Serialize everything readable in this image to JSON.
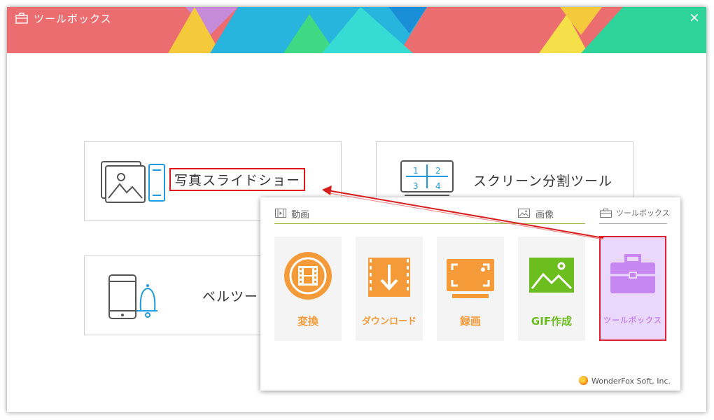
{
  "window": {
    "title": "ツールボックス",
    "close_glyph": "×"
  },
  "cards": {
    "photo_slideshow": {
      "label": "写真スライドショー"
    },
    "screen_split": {
      "label": "スクリーン分割ツール",
      "cells": [
        "1",
        "2",
        "3",
        "4"
      ]
    },
    "bell_tool": {
      "label": "ベルツー"
    }
  },
  "popup": {
    "section_video": "動画",
    "section_image": "画像",
    "section_toolbox": "ツールボックス",
    "tiles": [
      {
        "label": "変換",
        "color": "#f59a38"
      },
      {
        "label": "ダウンロード",
        "color": "#f59a38"
      },
      {
        "label": "録画",
        "color": "#f59a38"
      },
      {
        "label": "GIF作成",
        "color": "#6cbd1e"
      },
      {
        "label": "ツールボックス",
        "color": "#c787f0"
      }
    ],
    "footer": "WonderFox Soft, Inc."
  },
  "colors": {
    "accent_orange": "#f59a38",
    "accent_green": "#6cbd1e",
    "accent_purple": "#c787f0",
    "highlight_red": "#e0151c"
  }
}
